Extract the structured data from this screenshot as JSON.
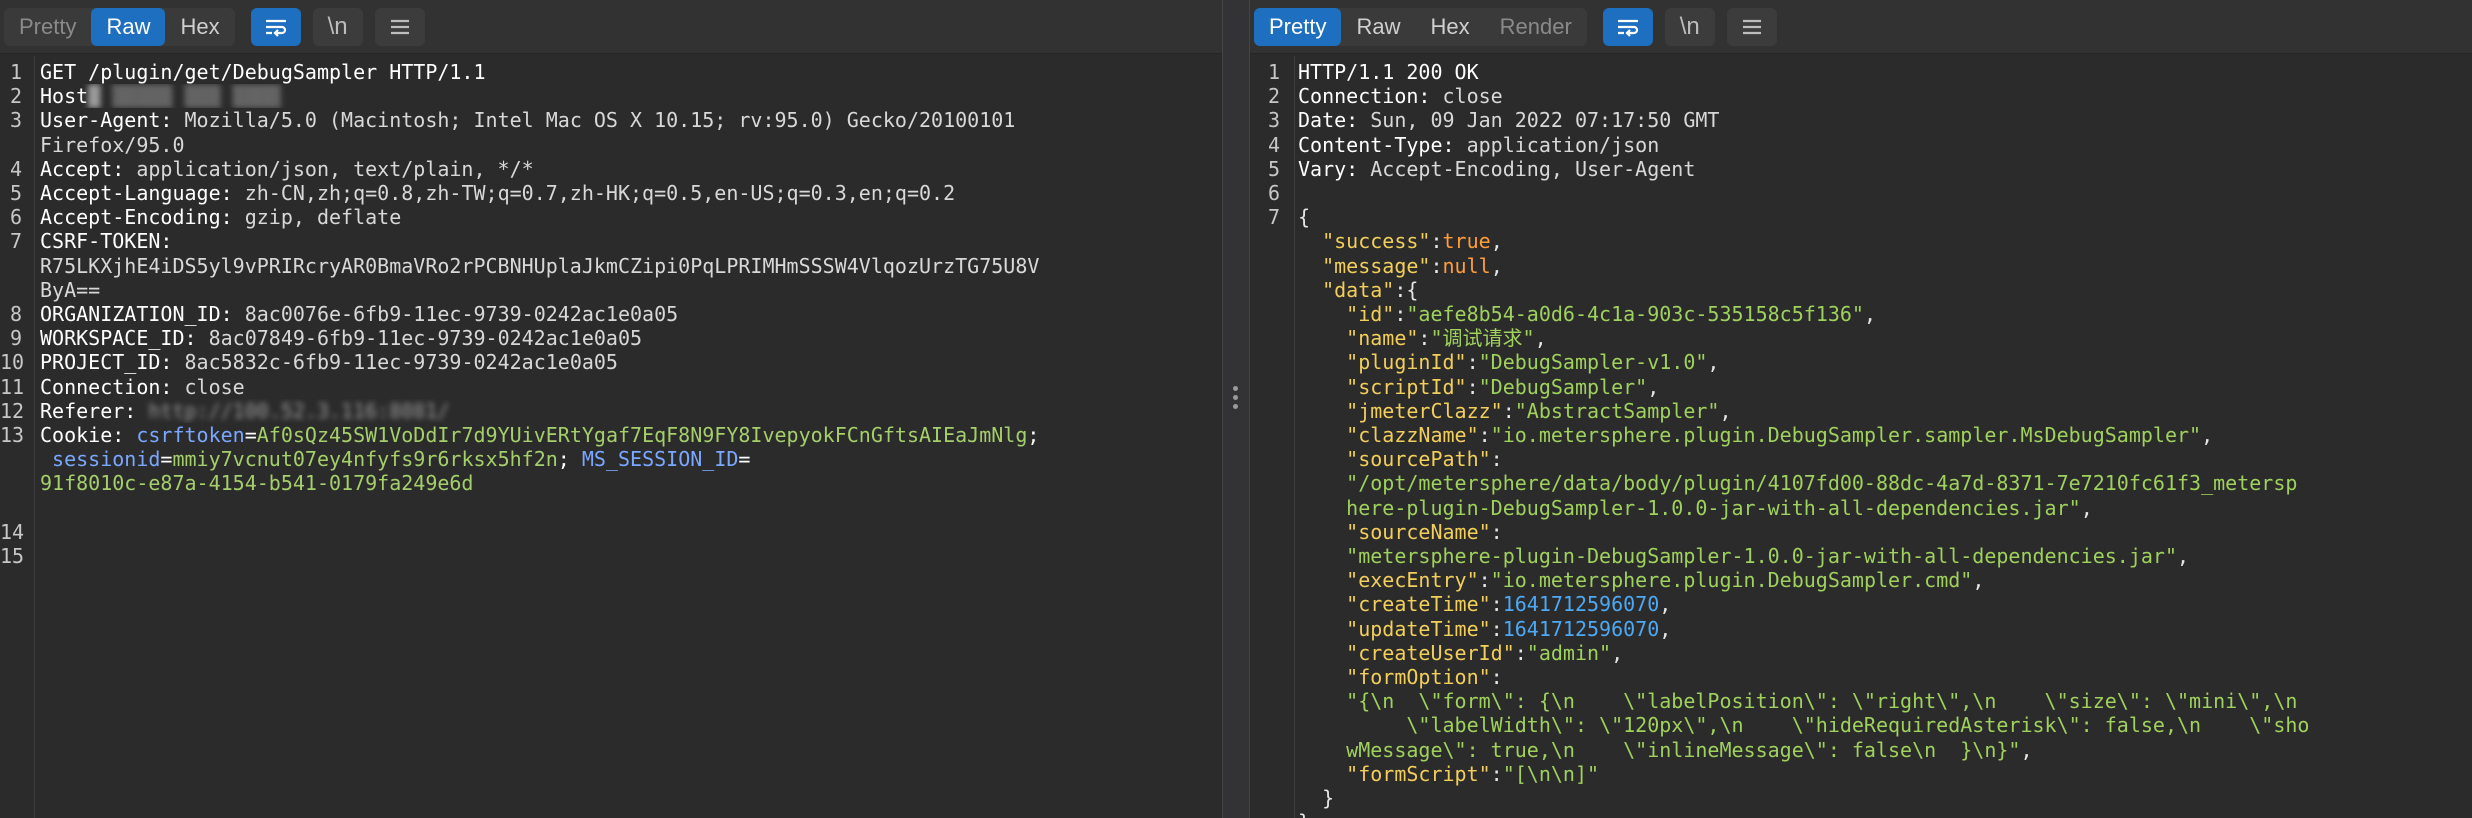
{
  "request": {
    "tabs": [
      "Pretty",
      "Raw",
      "Hex"
    ],
    "active_tab": "Raw",
    "newline_label": "\\n",
    "lines": [
      {
        "n": "1",
        "parts": [
          [
            "k",
            "GET /plugin/get/DebugSampler HTTP/1.1"
          ]
        ]
      },
      {
        "n": "2",
        "parts": [
          [
            "k",
            "Host"
          ],
          [
            "blur",
            "█ ▒▒▒▒▒ ▒▒▒ ▒▒▒▒"
          ]
        ]
      },
      {
        "n": "3",
        "parts": [
          [
            "k",
            "User-Agent: "
          ],
          [
            "hv",
            "Mozilla/5.0 (Macintosh; Intel Mac OS X 10.15; rv:95.0) Gecko/20100101"
          ]
        ]
      },
      {
        "n": "",
        "parts": [
          [
            "hv",
            "Firefox/95.0"
          ]
        ]
      },
      {
        "n": "4",
        "parts": [
          [
            "k",
            "Accept: "
          ],
          [
            "hv",
            "application/json, text/plain, */*"
          ]
        ]
      },
      {
        "n": "5",
        "parts": [
          [
            "k",
            "Accept-Language: "
          ],
          [
            "hv",
            "zh-CN,zh;q=0.8,zh-TW;q=0.7,zh-HK;q=0.5,en-US;q=0.3,en;q=0.2"
          ]
        ]
      },
      {
        "n": "6",
        "parts": [
          [
            "k",
            "Accept-Encoding: "
          ],
          [
            "hv",
            "gzip, deflate"
          ]
        ]
      },
      {
        "n": "7",
        "parts": [
          [
            "k",
            "CSRF-TOKEN:"
          ]
        ]
      },
      {
        "n": "",
        "parts": [
          [
            "hv",
            "R75LKXjhE4iDS5yl9vPRIRcryAR0BmaVRo2rPCBNHUplaJkmCZipi0PqLPRIMHmSSSW4VlqozUrzTG75U8V"
          ]
        ]
      },
      {
        "n": "",
        "parts": [
          [
            "hv",
            "ByA=="
          ]
        ]
      },
      {
        "n": "8",
        "parts": [
          [
            "k",
            "ORGANIZATION_ID: "
          ],
          [
            "hv",
            "8ac0076e-6fb9-11ec-9739-0242ac1e0a05"
          ]
        ]
      },
      {
        "n": "9",
        "parts": [
          [
            "k",
            "WORKSPACE_ID: "
          ],
          [
            "hv",
            "8ac07849-6fb9-11ec-9739-0242ac1e0a05"
          ]
        ]
      },
      {
        "n": "10",
        "parts": [
          [
            "k",
            "PROJECT_ID: "
          ],
          [
            "hv",
            "8ac5832c-6fb9-11ec-9739-0242ac1e0a05"
          ]
        ]
      },
      {
        "n": "11",
        "parts": [
          [
            "k",
            "Connection: "
          ],
          [
            "hv",
            "close"
          ]
        ]
      },
      {
        "n": "12",
        "parts": [
          [
            "k",
            "Referer: "
          ],
          [
            "blur",
            "http://100.52.3.116:8081/"
          ]
        ]
      },
      {
        "n": "13",
        "parts": [
          [
            "k",
            "Cookie: "
          ],
          [
            "ck",
            "csrftoken"
          ],
          [
            "k",
            "="
          ],
          [
            "cv",
            "Af0sQz45SW1VoDdIr7d9YUivERtYgaf7EqF8N9FY8IvepyokFCnGftsAIEaJmNlg"
          ],
          [
            "k",
            ";"
          ]
        ]
      },
      {
        "n": "",
        "parts": [
          [
            "k",
            " "
          ],
          [
            "ck",
            "sessionid"
          ],
          [
            "k",
            "="
          ],
          [
            "cv",
            "mmiy7vcnut07ey4nfyfs9r6rksx5hf2n"
          ],
          [
            "k",
            "; "
          ],
          [
            "ck",
            "MS_SESSION_ID"
          ],
          [
            "k",
            "="
          ]
        ]
      },
      {
        "n": "",
        "parts": [
          [
            "cv",
            "91f8010c-e87a-4154-b541-0179fa249e6d"
          ]
        ]
      },
      {
        "n": "14",
        "parts": []
      },
      {
        "n": "15",
        "parts": []
      }
    ],
    "row_map": [
      0,
      1,
      2,
      3,
      4,
      5,
      6,
      7,
      8,
      9,
      10,
      11,
      12,
      13,
      14,
      15,
      16,
      17,
      19,
      20
    ]
  },
  "response": {
    "tabs": [
      "Pretty",
      "Raw",
      "Hex",
      "Render"
    ],
    "active_tab": "Pretty",
    "newline_label": "\\n",
    "lines": [
      {
        "n": "1",
        "parts": [
          [
            "k",
            "HTTP/1.1 200 OK"
          ]
        ]
      },
      {
        "n": "2",
        "parts": [
          [
            "k",
            "Connection: "
          ],
          [
            "hv",
            "close"
          ]
        ]
      },
      {
        "n": "3",
        "parts": [
          [
            "k",
            "Date: "
          ],
          [
            "hv",
            "Sun, 09 Jan 2022 07:17:50 GMT"
          ]
        ]
      },
      {
        "n": "4",
        "parts": [
          [
            "k",
            "Content-Type: "
          ],
          [
            "hv",
            "application/json"
          ]
        ]
      },
      {
        "n": "5",
        "parts": [
          [
            "k",
            "Vary: "
          ],
          [
            "hv",
            "Accept-Encoding, User-Agent"
          ]
        ]
      },
      {
        "n": "6",
        "parts": []
      },
      {
        "n": "7",
        "parts": [
          [
            "jp",
            "{"
          ]
        ]
      },
      {
        "n": "",
        "parts": [
          [
            "jp",
            "  "
          ],
          [
            "jk",
            "\"success\""
          ],
          [
            "jp",
            ":"
          ],
          [
            "jb",
            "true"
          ],
          [
            "jp",
            ","
          ]
        ]
      },
      {
        "n": "",
        "parts": [
          [
            "jp",
            "  "
          ],
          [
            "jk",
            "\"message\""
          ],
          [
            "jp",
            ":"
          ],
          [
            "jb",
            "null"
          ],
          [
            "jp",
            ","
          ]
        ]
      },
      {
        "n": "",
        "parts": [
          [
            "jp",
            "  "
          ],
          [
            "jk",
            "\"data\""
          ],
          [
            "jp",
            ":{"
          ]
        ]
      },
      {
        "n": "",
        "parts": [
          [
            "jp",
            "    "
          ],
          [
            "jk",
            "\"id\""
          ],
          [
            "jp",
            ":"
          ],
          [
            "js",
            "\"aefe8b54-a0d6-4c1a-903c-535158c5f136\""
          ],
          [
            "jp",
            ","
          ]
        ]
      },
      {
        "n": "",
        "parts": [
          [
            "jp",
            "    "
          ],
          [
            "jk",
            "\"name\""
          ],
          [
            "jp",
            ":"
          ],
          [
            "js",
            "\"调试请求\""
          ],
          [
            "jp",
            ","
          ]
        ]
      },
      {
        "n": "",
        "parts": [
          [
            "jp",
            "    "
          ],
          [
            "jk",
            "\"pluginId\""
          ],
          [
            "jp",
            ":"
          ],
          [
            "js",
            "\"DebugSampler-v1.0\""
          ],
          [
            "jp",
            ","
          ]
        ]
      },
      {
        "n": "",
        "parts": [
          [
            "jp",
            "    "
          ],
          [
            "jk",
            "\"scriptId\""
          ],
          [
            "jp",
            ":"
          ],
          [
            "js",
            "\"DebugSampler\""
          ],
          [
            "jp",
            ","
          ]
        ]
      },
      {
        "n": "",
        "parts": [
          [
            "jp",
            "    "
          ],
          [
            "jk",
            "\"jmeterClazz\""
          ],
          [
            "jp",
            ":"
          ],
          [
            "js",
            "\"AbstractSampler\""
          ],
          [
            "jp",
            ","
          ]
        ]
      },
      {
        "n": "",
        "parts": [
          [
            "jp",
            "    "
          ],
          [
            "jk",
            "\"clazzName\""
          ],
          [
            "jp",
            ":"
          ],
          [
            "js",
            "\"io.metersphere.plugin.DebugSampler.sampler.MsDebugSampler\""
          ],
          [
            "jp",
            ","
          ]
        ]
      },
      {
        "n": "",
        "parts": [
          [
            "jp",
            "    "
          ],
          [
            "jk",
            "\"sourcePath\""
          ],
          [
            "jp",
            ":"
          ]
        ]
      },
      {
        "n": "",
        "parts": [
          [
            "jp",
            "    "
          ],
          [
            "js",
            "\"/opt/metersphere/data/body/plugin/4107fd00-88dc-4a7d-8371-7e7210fc61f3_metersp"
          ]
        ]
      },
      {
        "n": "",
        "parts": [
          [
            "jp",
            "    "
          ],
          [
            "js",
            "here-plugin-DebugSampler-1.0.0-jar-with-all-dependencies.jar\""
          ],
          [
            "jp",
            ","
          ]
        ]
      },
      {
        "n": "",
        "parts": [
          [
            "jp",
            "    "
          ],
          [
            "jk",
            "\"sourceName\""
          ],
          [
            "jp",
            ":"
          ]
        ]
      },
      {
        "n": "",
        "parts": [
          [
            "jp",
            "    "
          ],
          [
            "js",
            "\"metersphere-plugin-DebugSampler-1.0.0-jar-with-all-dependencies.jar\""
          ],
          [
            "jp",
            ","
          ]
        ]
      },
      {
        "n": "",
        "parts": [
          [
            "jp",
            "    "
          ],
          [
            "jk",
            "\"execEntry\""
          ],
          [
            "jp",
            ":"
          ],
          [
            "js",
            "\"io.metersphere.plugin.DebugSampler.cmd\""
          ],
          [
            "jp",
            ","
          ]
        ]
      },
      {
        "n": "",
        "parts": [
          [
            "jp",
            "    "
          ],
          [
            "jk",
            "\"createTime\""
          ],
          [
            "jp",
            ":"
          ],
          [
            "jn",
            "1641712596070"
          ],
          [
            "jp",
            ","
          ]
        ]
      },
      {
        "n": "",
        "parts": [
          [
            "jp",
            "    "
          ],
          [
            "jk",
            "\"updateTime\""
          ],
          [
            "jp",
            ":"
          ],
          [
            "jn",
            "1641712596070"
          ],
          [
            "jp",
            ","
          ]
        ]
      },
      {
        "n": "",
        "parts": [
          [
            "jp",
            "    "
          ],
          [
            "jk",
            "\"createUserId\""
          ],
          [
            "jp",
            ":"
          ],
          [
            "js",
            "\"admin\""
          ],
          [
            "jp",
            ","
          ]
        ]
      },
      {
        "n": "",
        "parts": [
          [
            "jp",
            "    "
          ],
          [
            "jk",
            "\"formOption\""
          ],
          [
            "jp",
            ":"
          ]
        ]
      },
      {
        "n": "",
        "parts": [
          [
            "jp",
            "    "
          ],
          [
            "js",
            "\"{\\n  \\\"form\\\": {\\n    \\\"labelPosition\\\": \\\"right\\\",\\n    \\\"size\\\": \\\"mini\\\",\\n"
          ]
        ]
      },
      {
        "n": "",
        "parts": [
          [
            "jp",
            "    "
          ],
          [
            "js",
            "     \\\"labelWidth\\\": \\\"120px\\\",\\n    \\\"hideRequiredAsterisk\\\": false,\\n    \\\"sho"
          ]
        ]
      },
      {
        "n": "",
        "parts": [
          [
            "jp",
            "    "
          ],
          [
            "js",
            "wMessage\\\": true,\\n    \\\"inlineMessage\\\": false\\n  }\\n}\""
          ],
          [
            "jp",
            ","
          ]
        ]
      },
      {
        "n": "",
        "parts": [
          [
            "jp",
            "    "
          ],
          [
            "jk",
            "\"formScript\""
          ],
          [
            "jp",
            ":"
          ],
          [
            "js",
            "\"[\\n\\n]\""
          ]
        ]
      },
      {
        "n": "",
        "parts": [
          [
            "jp",
            "  }"
          ]
        ]
      },
      {
        "n": "",
        "parts": [
          [
            "jp",
            "}"
          ]
        ]
      }
    ]
  }
}
